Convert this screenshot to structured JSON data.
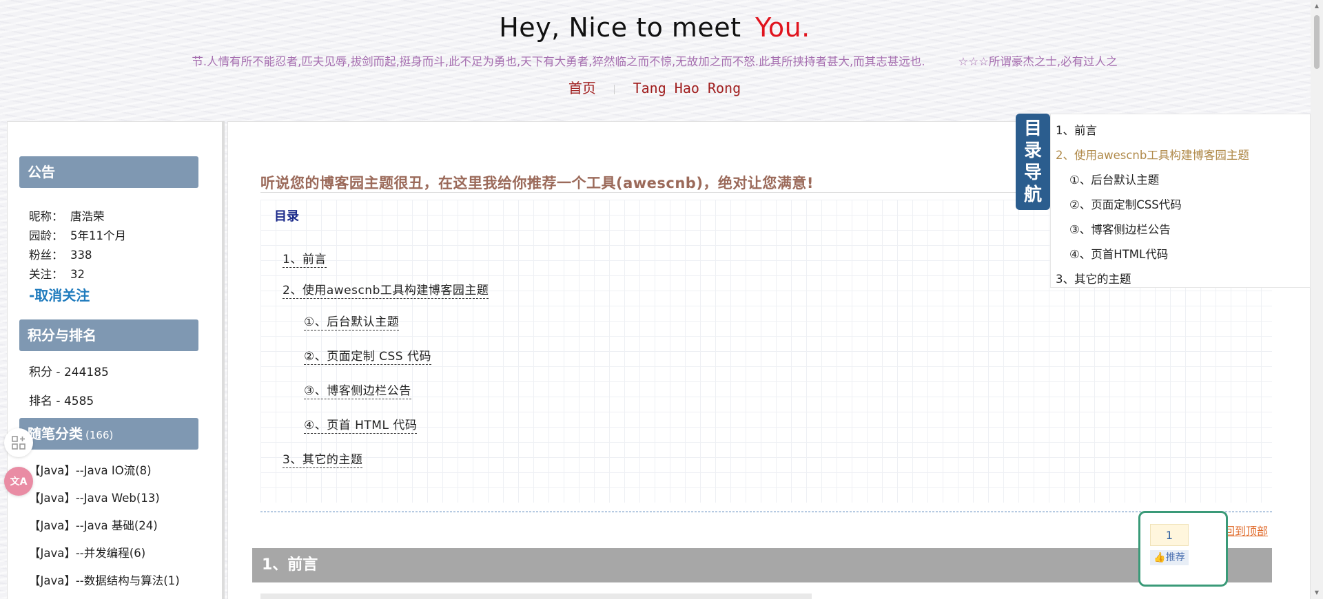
{
  "header": {
    "title_main": "Hey, Nice to meet",
    "title_accent": "You.",
    "motto_left": "节.人情有所不能忍者,匹夫见辱,拔剑而起,挺身而斗,此不足为勇也,天下有大勇者,猝然临之而不惊,无故加之而不怒.此其所挟持者甚大,而其志甚远也.",
    "motto_right": "☆☆☆所谓豪杰之士,必有过人之",
    "nav_home": "首页",
    "nav_name": "Tang Hao Rong"
  },
  "sidebar": {
    "notice": {
      "heading": "公告",
      "rows": [
        {
          "k": "昵称：",
          "v": "唐浩荣"
        },
        {
          "k": "园龄：",
          "v": "5年11个月"
        },
        {
          "k": "粉丝：",
          "v": "338"
        },
        {
          "k": "关注：",
          "v": "32"
        }
      ],
      "unfollow": "-取消关注"
    },
    "score": {
      "heading": "积分与排名",
      "points": "积分 - 244185",
      "rank": "排名 - 4585"
    },
    "categories": {
      "heading": "随笔分类",
      "count": "(166)",
      "items": [
        "【Java】--Java IO流(8)",
        "【Java】--Java Web(13)",
        "【Java】--Java 基础(24)",
        "【Java】--并发编程(6)",
        "【Java】--数据结构与算法(1)"
      ]
    }
  },
  "tools": {
    "grid_icon": "grid-plus-icon",
    "translate_icon": "translate-icon",
    "translate_glyph": "文A"
  },
  "post": {
    "title": "听说您的博客园主题很丑，在这里我给你推荐一个工具(awescnb)，绝对让您满意!",
    "toc_label": "目录",
    "toc": [
      "1、前言",
      "2、使用awescnb工具构建博客园主题",
      "①、后台默认主题",
      "②、页面定制 CSS 代码",
      "③、博客侧边栏公告",
      "④、页首 HTML 代码",
      "3、其它的主题"
    ],
    "back_to_top": "回到顶部",
    "section_1": "1、前言"
  },
  "recommend": {
    "count": "1",
    "label": "推荐"
  },
  "tocnav": {
    "tab": [
      "目",
      "录",
      "导",
      "航"
    ],
    "items": [
      "1、前言",
      "2、使用awescnb工具构建博客园主题",
      "①、后台默认主题",
      "②、页面定制CSS代码",
      "③、博客侧边栏公告",
      "④、页首HTML代码",
      "3、其它的主题"
    ]
  },
  "colors": {
    "accent_red": "#e0141e",
    "motto_purple": "#a66fb0",
    "sidebar_head": "#7f98b2",
    "toc_active": "#b08a4a",
    "tocnav_tab": "#2b5d8e"
  }
}
